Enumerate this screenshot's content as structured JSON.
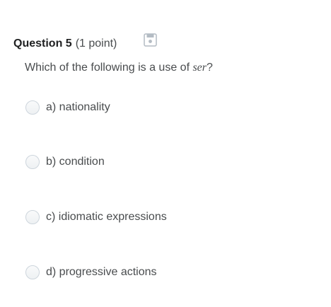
{
  "question": {
    "number_label": "Question 5",
    "points_label": "(1 point)",
    "prompt_before": "Which of the following is a use of ",
    "prompt_term": "ser",
    "prompt_after": "?",
    "save_icon": "save-disk-icon"
  },
  "options": [
    {
      "label": "a) nationality"
    },
    {
      "label": "b) condition"
    },
    {
      "label": "c) idiomatic expressions"
    },
    {
      "label": "d) progressive actions"
    }
  ],
  "colors": {
    "text": "#494c4e",
    "heading": "#202122",
    "radio_border": "#cdd5dc",
    "icon": "#b4bcc4"
  }
}
